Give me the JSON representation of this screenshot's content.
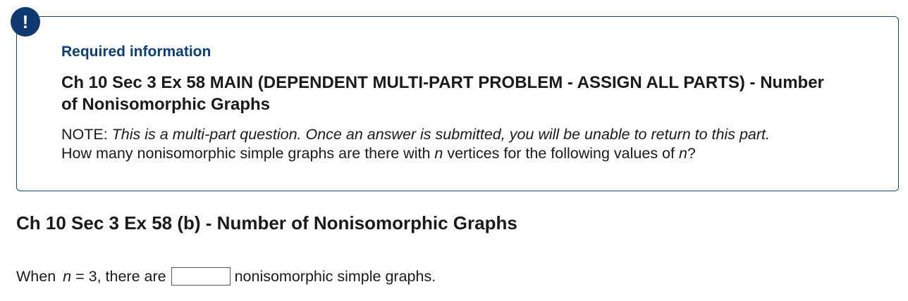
{
  "alert_badge": {
    "symbol": "!",
    "icon": "exclamation-icon",
    "color": "#0f3a70"
  },
  "info_box": {
    "heading": "Required information",
    "title": "Ch 10 Sec 3 Ex 58 MAIN (DEPENDENT MULTI-PART PROBLEM - ASSIGN ALL PARTS) - Number of Nonisomorphic Graphs",
    "note_label": "NOTE: ",
    "note_text": "This is a multi-part question. Once an answer is submitted, you will be unable to return to this part.",
    "question_pre": "How many nonisomorphic simple graphs are there with ",
    "question_var1": "n",
    "question_mid": " vertices for the following values of ",
    "question_var2": "n",
    "question_post": "?"
  },
  "part": {
    "title": "Ch 10 Sec 3 Ex 58 (b) - Number of Nonisomorphic Graphs",
    "prompt_pre": "When ",
    "prompt_var": "n",
    "prompt_eq": " = 3, there are",
    "answer_value": "",
    "prompt_post": "nonisomorphic simple graphs."
  },
  "colors": {
    "accent": "#0d3d75",
    "border": "#1d3f72"
  }
}
